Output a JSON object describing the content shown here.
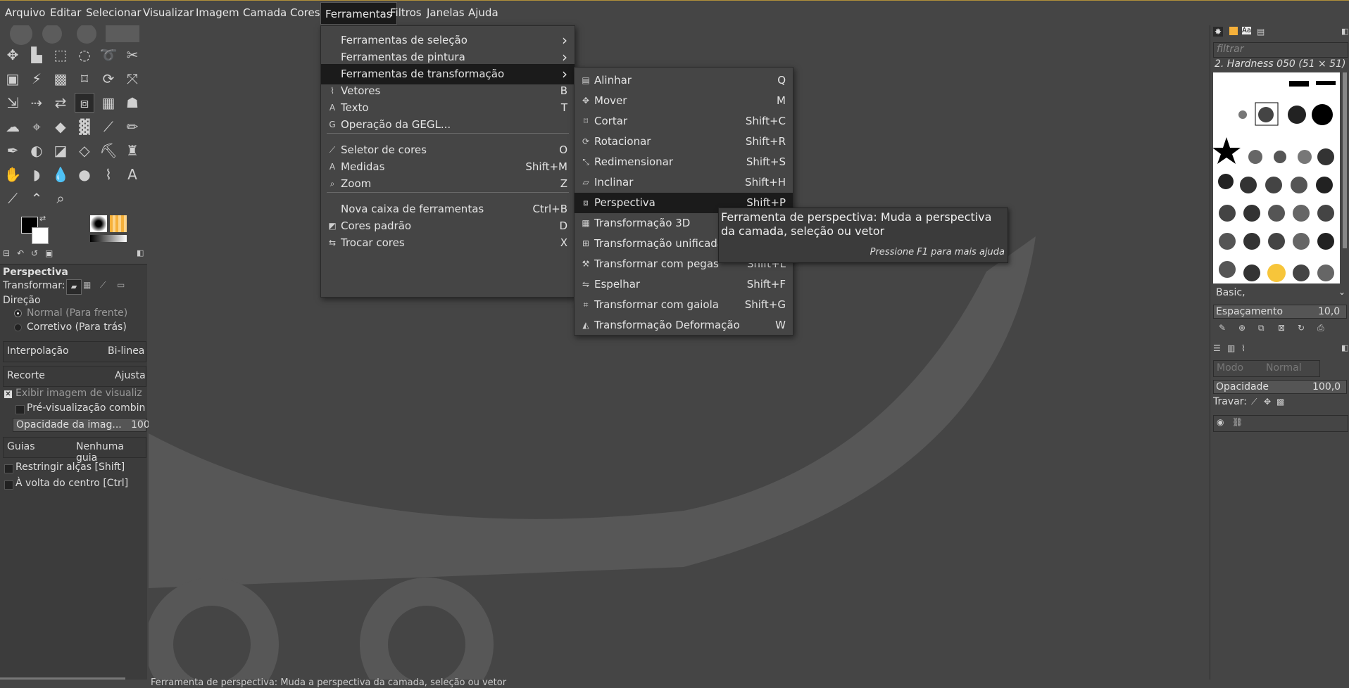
{
  "menubar": {
    "items": [
      "Arquivo",
      "Editar",
      "Selecionar",
      "Visualizar",
      "Imagem",
      "Camada",
      "Cores",
      "Ferramentas",
      "Filtros",
      "Janelas",
      "Ajuda"
    ]
  },
  "tools_menu": {
    "items": [
      {
        "label": "Ferramentas de seleção",
        "shortcut": "",
        "icon": "",
        "submenu": true
      },
      {
        "label": "Ferramentas de pintura",
        "shortcut": "",
        "icon": "",
        "submenu": true
      },
      {
        "label": "Ferramentas de transformação",
        "shortcut": "",
        "icon": "",
        "submenu": true
      },
      {
        "label": "Vetores",
        "shortcut": "B",
        "icon": "vector-path-icon",
        "submenu": false
      },
      {
        "label": "Texto",
        "shortcut": "T",
        "icon": "text-icon",
        "submenu": false
      },
      {
        "label": "Operação da GEGL...",
        "shortcut": "",
        "icon": "gegl-icon",
        "submenu": false
      },
      {
        "label": "Seletor de cores",
        "shortcut": "O",
        "icon": "color-picker-icon",
        "submenu": false
      },
      {
        "label": "Medidas",
        "shortcut": "Shift+M",
        "icon": "measure-icon",
        "submenu": false
      },
      {
        "label": "Zoom",
        "shortcut": "Z",
        "icon": "zoom-icon",
        "submenu": false
      },
      {
        "label": "Nova caixa de ferramentas",
        "shortcut": "Ctrl+B",
        "icon": "",
        "submenu": false
      },
      {
        "label": "Cores padrão",
        "shortcut": "D",
        "icon": "default-colors-icon",
        "submenu": false
      },
      {
        "label": "Trocar cores",
        "shortcut": "X",
        "icon": "swap-colors-icon",
        "submenu": false
      }
    ]
  },
  "transform_menu": {
    "items": [
      {
        "label": "Alinhar",
        "shortcut": "Q",
        "icon": "align-icon"
      },
      {
        "label": "Mover",
        "shortcut": "M",
        "icon": "move-icon"
      },
      {
        "label": "Cortar",
        "shortcut": "Shift+C",
        "icon": "crop-icon"
      },
      {
        "label": "Rotacionar",
        "shortcut": "Shift+R",
        "icon": "rotate-icon"
      },
      {
        "label": "Redimensionar",
        "shortcut": "Shift+S",
        "icon": "scale-icon"
      },
      {
        "label": "Inclinar",
        "shortcut": "Shift+H",
        "icon": "shear-icon"
      },
      {
        "label": "Perspectiva",
        "shortcut": "Shift+P",
        "icon": "perspective-icon"
      },
      {
        "label": "Transformação 3D",
        "shortcut": "",
        "icon": "transform-3d-icon"
      },
      {
        "label": "Transformação unificada",
        "shortcut": "",
        "icon": "unified-transform-icon"
      },
      {
        "label": "Transformar com pegas",
        "shortcut": "Shift+L",
        "icon": "handle-transform-icon"
      },
      {
        "label": "Espelhar",
        "shortcut": "Shift+F",
        "icon": "flip-icon"
      },
      {
        "label": "Transformar com gaiola",
        "shortcut": "Shift+G",
        "icon": "cage-transform-icon"
      },
      {
        "label": "Transformação Deformação",
        "shortcut": "W",
        "icon": "warp-transform-icon"
      }
    ]
  },
  "tooltip": {
    "line1": "Ferramenta de perspectiva: Muda a perspectiva",
    "line2": "da camada, seleção ou vetor",
    "help": "Pressione F1 para mais ajuda"
  },
  "tool_options": {
    "title": "Perspectiva",
    "transform_label": "Transformar:",
    "direction_label": "Direção",
    "dir_normal": "Normal (Para frente)",
    "dir_corrective": "Corretivo (Para trás)",
    "interp_label": "Interpolação",
    "interp_value": "Bi-linea",
    "clip_label": "Recorte",
    "clip_value": "Ajusta",
    "show_preview": "Exibir imagem de visualiz",
    "composited_preview": "Pré-visualização combin",
    "preview_opacity": "Opacidade da imag...",
    "preview_opacity_value": "100",
    "guides_label": "Guias",
    "guides_value": "Nenhuma guia",
    "constrain": "Restringir alças [Shift]",
    "around_center": "À volta do centro [Ctrl]"
  },
  "status": {
    "text": "Ferramenta de perspectiva: Muda a perspectiva da camada, seleção ou vetor"
  },
  "brushes": {
    "filter_placeholder": "filtrar",
    "brush_name": "2. Hardness 050 (51 × 51)",
    "preset": "Basic,",
    "spacing_label": "Espaçamento",
    "spacing_value": "10,0"
  },
  "layers": {
    "mode_label": "Modo",
    "mode_value": "Normal",
    "opacity_label": "Opacidade",
    "opacity_value": "100,0",
    "lock_label": "Travar:"
  },
  "colors": {
    "accent": "#b08f3a",
    "highlight": "#1b1b1b",
    "fg": "#000000",
    "bg": "#ffffff"
  }
}
